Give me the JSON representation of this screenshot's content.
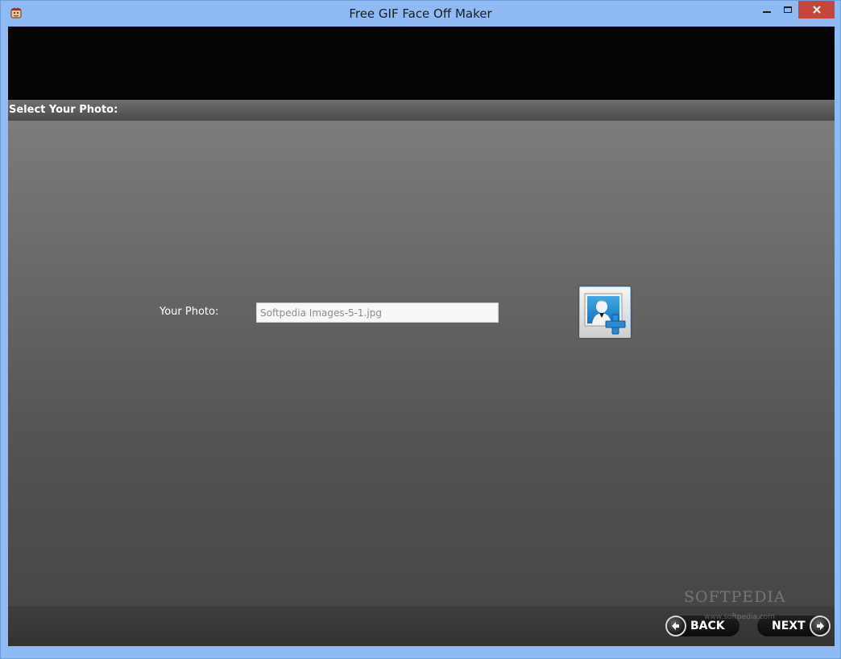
{
  "window": {
    "title": "Free GIF Face Off Maker",
    "controls": [
      "minimize",
      "maximize",
      "close"
    ]
  },
  "section": {
    "title": "Select Your Photo:"
  },
  "photo": {
    "label": "Your Photo:",
    "value": "Softpedia Images-5-1.jpg",
    "add_button_icon": "add-photo-icon"
  },
  "navigation": {
    "back_label": "BACK",
    "next_label": "NEXT"
  },
  "watermark": {
    "text": "SOFTPEDIA",
    "url": "www.softpedia.com"
  },
  "colors": {
    "titlebar": "#8fbaf3",
    "close_button": "#c7463b",
    "header_band": "#050505",
    "panel_top": "#7c7c7c",
    "panel_bottom": "#474747"
  }
}
